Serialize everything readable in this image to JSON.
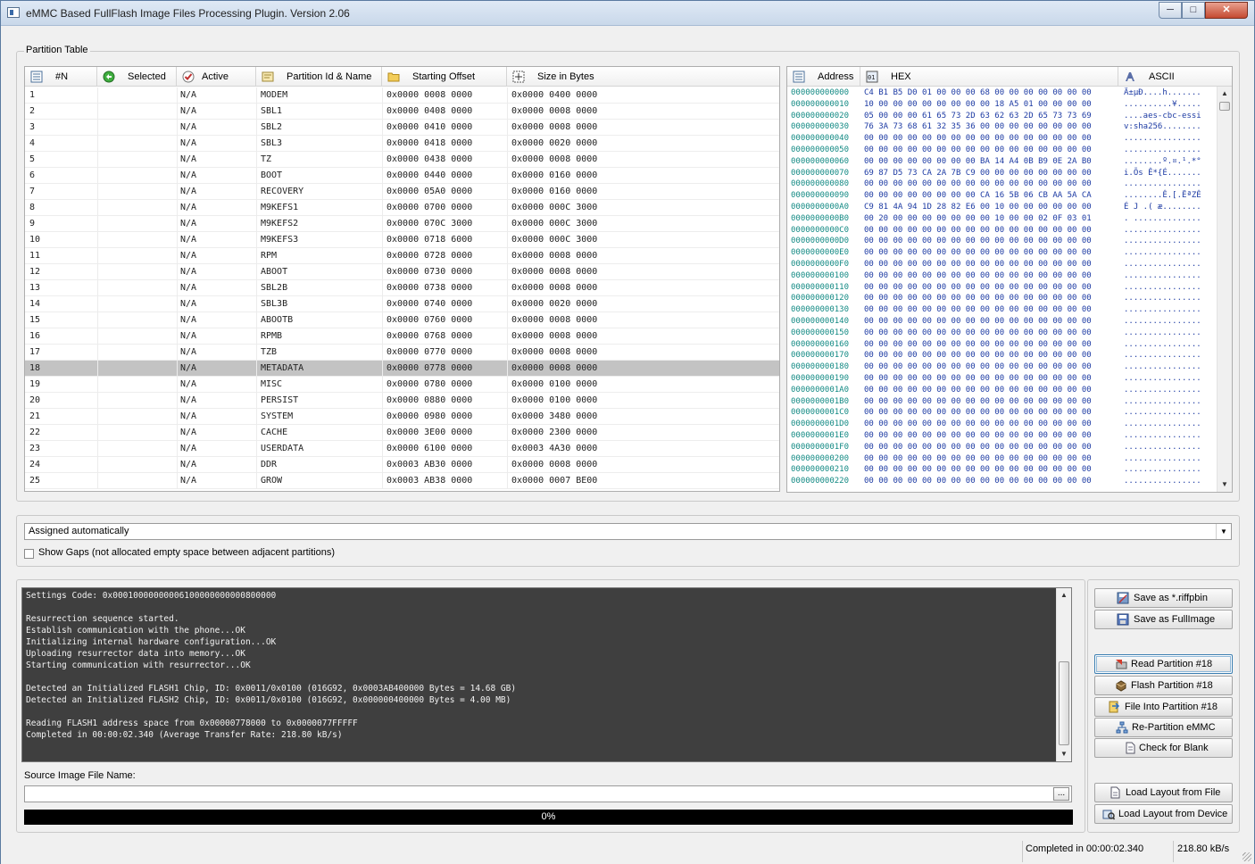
{
  "window": {
    "title": "eMMC Based FullFlash Image Files Processing Plugin. Version 2.06",
    "controls": {
      "minimize": "─",
      "maximize": "□",
      "close": "✕"
    }
  },
  "partition_table": {
    "group_label": "Partition Table",
    "columns": [
      "#N",
      "Selected",
      "Active",
      "Partition Id & Name",
      "Starting Offset",
      "Size in Bytes"
    ],
    "column_icons": [
      "list-icon",
      "selected-icon",
      "active-check-icon",
      "partition-id-icon",
      "folder-icon",
      "size-icon"
    ],
    "selected_row": "18",
    "rows": [
      {
        "n": "1",
        "selected": "",
        "active": "N/A",
        "name": "MODEM",
        "offset": "0x0000 0008 0000",
        "size": "0x0000 0400 0000"
      },
      {
        "n": "2",
        "selected": "",
        "active": "N/A",
        "name": "SBL1",
        "offset": "0x0000 0408 0000",
        "size": "0x0000 0008 0000"
      },
      {
        "n": "3",
        "selected": "",
        "active": "N/A",
        "name": "SBL2",
        "offset": "0x0000 0410 0000",
        "size": "0x0000 0008 0000"
      },
      {
        "n": "4",
        "selected": "",
        "active": "N/A",
        "name": "SBL3",
        "offset": "0x0000 0418 0000",
        "size": "0x0000 0020 0000"
      },
      {
        "n": "5",
        "selected": "",
        "active": "N/A",
        "name": "TZ",
        "offset": "0x0000 0438 0000",
        "size": "0x0000 0008 0000"
      },
      {
        "n": "6",
        "selected": "",
        "active": "N/A",
        "name": "BOOT",
        "offset": "0x0000 0440 0000",
        "size": "0x0000 0160 0000"
      },
      {
        "n": "7",
        "selected": "",
        "active": "N/A",
        "name": "RECOVERY",
        "offset": "0x0000 05A0 0000",
        "size": "0x0000 0160 0000"
      },
      {
        "n": "8",
        "selected": "",
        "active": "N/A",
        "name": "M9KEFS1",
        "offset": "0x0000 0700 0000",
        "size": "0x0000 000C 3000"
      },
      {
        "n": "9",
        "selected": "",
        "active": "N/A",
        "name": "M9KEFS2",
        "offset": "0x0000 070C 3000",
        "size": "0x0000 000C 3000"
      },
      {
        "n": "10",
        "selected": "",
        "active": "N/A",
        "name": "M9KEFS3",
        "offset": "0x0000 0718 6000",
        "size": "0x0000 000C 3000"
      },
      {
        "n": "11",
        "selected": "",
        "active": "N/A",
        "name": "RPM",
        "offset": "0x0000 0728 0000",
        "size": "0x0000 0008 0000"
      },
      {
        "n": "12",
        "selected": "",
        "active": "N/A",
        "name": "ABOOT",
        "offset": "0x0000 0730 0000",
        "size": "0x0000 0008 0000"
      },
      {
        "n": "13",
        "selected": "",
        "active": "N/A",
        "name": "SBL2B",
        "offset": "0x0000 0738 0000",
        "size": "0x0000 0008 0000"
      },
      {
        "n": "14",
        "selected": "",
        "active": "N/A",
        "name": "SBL3B",
        "offset": "0x0000 0740 0000",
        "size": "0x0000 0020 0000"
      },
      {
        "n": "15",
        "selected": "",
        "active": "N/A",
        "name": "ABOOTB",
        "offset": "0x0000 0760 0000",
        "size": "0x0000 0008 0000"
      },
      {
        "n": "16",
        "selected": "",
        "active": "N/A",
        "name": "RPMB",
        "offset": "0x0000 0768 0000",
        "size": "0x0000 0008 0000"
      },
      {
        "n": "17",
        "selected": "",
        "active": "N/A",
        "name": "TZB",
        "offset": "0x0000 0770 0000",
        "size": "0x0000 0008 0000"
      },
      {
        "n": "18",
        "selected": "",
        "active": "N/A",
        "name": "METADATA",
        "offset": "0x0000 0778 0000",
        "size": "0x0000 0008 0000"
      },
      {
        "n": "19",
        "selected": "",
        "active": "N/A",
        "name": "MISC",
        "offset": "0x0000 0780 0000",
        "size": "0x0000 0100 0000"
      },
      {
        "n": "20",
        "selected": "",
        "active": "N/A",
        "name": "PERSIST",
        "offset": "0x0000 0880 0000",
        "size": "0x0000 0100 0000"
      },
      {
        "n": "21",
        "selected": "",
        "active": "N/A",
        "name": "SYSTEM",
        "offset": "0x0000 0980 0000",
        "size": "0x0000 3480 0000"
      },
      {
        "n": "22",
        "selected": "",
        "active": "N/A",
        "name": "CACHE",
        "offset": "0x0000 3E00 0000",
        "size": "0x0000 2300 0000"
      },
      {
        "n": "23",
        "selected": "",
        "active": "N/A",
        "name": "USERDATA",
        "offset": "0x0000 6100 0000",
        "size": "0x0003 4A30 0000"
      },
      {
        "n": "24",
        "selected": "",
        "active": "N/A",
        "name": "DDR",
        "offset": "0x0003 AB30 0000",
        "size": "0x0000 0008 0000"
      },
      {
        "n": "25",
        "selected": "",
        "active": "N/A",
        "name": "GROW",
        "offset": "0x0003 AB38 0000",
        "size": "0x0000 0007 BE00"
      }
    ]
  },
  "hex_view": {
    "columns": [
      "Address",
      "HEX",
      "ASCII"
    ],
    "column_icons": [
      "address-icon",
      "hex-icon",
      "ascii-icon"
    ],
    "rows": [
      {
        "addr": "000000000000",
        "hex": "C4 B1 B5 D0 01 00 00 00 68 00 00 00 00 00 00 00",
        "ascii": "Ä±µÐ....h......."
      },
      {
        "addr": "000000000010",
        "hex": "10 00 00 00 00 00 00 00 00 18 A5 01 00 00 00 00",
        "ascii": "..........¥....."
      },
      {
        "addr": "000000000020",
        "hex": "05 00 00 00 61 65 73 2D 63 62 63 2D 65 73 73 69",
        "ascii": "....aes-cbc-essi"
      },
      {
        "addr": "000000000030",
        "hex": "76 3A 73 68 61 32 35 36 00 00 00 00 00 00 00 00",
        "ascii": "v:sha256........"
      },
      {
        "addr": "000000000040",
        "hex": "00 00 00 00 00 00 00 00 00 00 00 00 00 00 00 00",
        "ascii": "................"
      },
      {
        "addr": "000000000050",
        "hex": "00 00 00 00 00 00 00 00 00 00 00 00 00 00 00 00",
        "ascii": "................"
      },
      {
        "addr": "000000000060",
        "hex": "00 00 00 00 00 00 00 00 BA 14 A4 0B B9 0E 2A B0",
        "ascii": "........º.¤.¹.*°"
      },
      {
        "addr": "000000000070",
        "hex": "69 87 D5 73 CA 2A 7B C9 00 00 00 00 00 00 00 00",
        "ascii": "i.Õs Ê*{É......."
      },
      {
        "addr": "000000000080",
        "hex": "00 00 00 00 00 00 00 00 00 00 00 00 00 00 00 00",
        "ascii": "................"
      },
      {
        "addr": "000000000090",
        "hex": "00 00 00 00 00 00 00 00 CA 16 5B 06 CB AA 5A CA",
        "ascii": "........Ê.[.ËªZÊ"
      },
      {
        "addr": "0000000000A0",
        "hex": "C9 81 4A 94 1D 28 82 E6 00 10 00 00 00 00 00 00",
        "ascii": "É J .( æ........"
      },
      {
        "addr": "0000000000B0",
        "hex": "00 20 00 00 00 00 00 00 00 10 00 00 02 0F 03 01",
        "ascii": ". .............."
      },
      {
        "addr": "0000000000C0",
        "hex": "00 00 00 00 00 00 00 00 00 00 00 00 00 00 00 00",
        "ascii": "................"
      },
      {
        "addr": "0000000000D0",
        "hex": "00 00 00 00 00 00 00 00 00 00 00 00 00 00 00 00",
        "ascii": "................"
      },
      {
        "addr": "0000000000E0",
        "hex": "00 00 00 00 00 00 00 00 00 00 00 00 00 00 00 00",
        "ascii": "................"
      },
      {
        "addr": "0000000000F0",
        "hex": "00 00 00 00 00 00 00 00 00 00 00 00 00 00 00 00",
        "ascii": "................"
      },
      {
        "addr": "000000000100",
        "hex": "00 00 00 00 00 00 00 00 00 00 00 00 00 00 00 00",
        "ascii": "................"
      },
      {
        "addr": "000000000110",
        "hex": "00 00 00 00 00 00 00 00 00 00 00 00 00 00 00 00",
        "ascii": "................"
      },
      {
        "addr": "000000000120",
        "hex": "00 00 00 00 00 00 00 00 00 00 00 00 00 00 00 00",
        "ascii": "................"
      },
      {
        "addr": "000000000130",
        "hex": "00 00 00 00 00 00 00 00 00 00 00 00 00 00 00 00",
        "ascii": "................"
      },
      {
        "addr": "000000000140",
        "hex": "00 00 00 00 00 00 00 00 00 00 00 00 00 00 00 00",
        "ascii": "................"
      },
      {
        "addr": "000000000150",
        "hex": "00 00 00 00 00 00 00 00 00 00 00 00 00 00 00 00",
        "ascii": "................"
      },
      {
        "addr": "000000000160",
        "hex": "00 00 00 00 00 00 00 00 00 00 00 00 00 00 00 00",
        "ascii": "................"
      },
      {
        "addr": "000000000170",
        "hex": "00 00 00 00 00 00 00 00 00 00 00 00 00 00 00 00",
        "ascii": "................"
      },
      {
        "addr": "000000000180",
        "hex": "00 00 00 00 00 00 00 00 00 00 00 00 00 00 00 00",
        "ascii": "................"
      },
      {
        "addr": "000000000190",
        "hex": "00 00 00 00 00 00 00 00 00 00 00 00 00 00 00 00",
        "ascii": "................"
      },
      {
        "addr": "0000000001A0",
        "hex": "00 00 00 00 00 00 00 00 00 00 00 00 00 00 00 00",
        "ascii": "................"
      },
      {
        "addr": "0000000001B0",
        "hex": "00 00 00 00 00 00 00 00 00 00 00 00 00 00 00 00",
        "ascii": "................"
      },
      {
        "addr": "0000000001C0",
        "hex": "00 00 00 00 00 00 00 00 00 00 00 00 00 00 00 00",
        "ascii": "................"
      },
      {
        "addr": "0000000001D0",
        "hex": "00 00 00 00 00 00 00 00 00 00 00 00 00 00 00 00",
        "ascii": "................"
      },
      {
        "addr": "0000000001E0",
        "hex": "00 00 00 00 00 00 00 00 00 00 00 00 00 00 00 00",
        "ascii": "................"
      },
      {
        "addr": "0000000001F0",
        "hex": "00 00 00 00 00 00 00 00 00 00 00 00 00 00 00 00",
        "ascii": "................"
      },
      {
        "addr": "000000000200",
        "hex": "00 00 00 00 00 00 00 00 00 00 00 00 00 00 00 00",
        "ascii": "................"
      },
      {
        "addr": "000000000210",
        "hex": "00 00 00 00 00 00 00 00 00 00 00 00 00 00 00 00",
        "ascii": "................"
      },
      {
        "addr": "000000000220",
        "hex": "00 00 00 00 00 00 00 00 00 00 00 00 00 00 00 00",
        "ascii": "................"
      }
    ]
  },
  "layout_select": {
    "value": "Assigned automatically"
  },
  "show_gaps": {
    "label": "Show Gaps (not allocated empty space between adjacent partitions)",
    "checked": false
  },
  "log": {
    "lines": [
      "Settings Code: 0x00010000000006100000000000800000",
      "",
      "Resurrection sequence started.",
      "Establish communication with the phone...OK",
      "Initializing internal hardware configuration...OK",
      "Uploading resurrector data into memory...OK",
      "Starting communication with resurrector...OK",
      "",
      "Detected an Initialized FLASH1 Chip, ID: 0x0011/0x0100 (016G92, 0x0003AB400000 Bytes = 14.68 GB)",
      "Detected an Initialized FLASH2 Chip, ID: 0x0011/0x0100 (016G92, 0x000000400000 Bytes = 4.00 MB)",
      "",
      "Reading FLASH1 address space from 0x00000778000 to 0x0000077FFFFF",
      "Completed in 00:00:02.340 (Average Transfer Rate: 218.80 kB/s)"
    ]
  },
  "source": {
    "label": "Source Image File Name:",
    "value": "",
    "browse_label": "..."
  },
  "progress": {
    "text": "0%",
    "value": 0
  },
  "buttons": {
    "save_riffpbin": "Save as *.riffpbin",
    "save_fullimage": "Save as FullImage",
    "read_partition": "Read Partition #18",
    "flash_partition": "Flash Partition #18",
    "file_into_partition": "File Into Partition #18",
    "repartition": "Re-Partition eMMC",
    "check_blank": "Check for Blank",
    "load_layout_file": "Load Layout from File",
    "load_layout_device": "Load Layout from Device"
  },
  "status_bar": {
    "completed": "Completed in 00:00:02.340",
    "rate": "218.80 kB/s"
  },
  "colors": {
    "accent": "#3c7fb1",
    "log_bg": "#3f3f3f",
    "hex_addr": "#138a84",
    "hex_bytes": "#1c3aa3",
    "selected_row": "#c3c3c3"
  }
}
